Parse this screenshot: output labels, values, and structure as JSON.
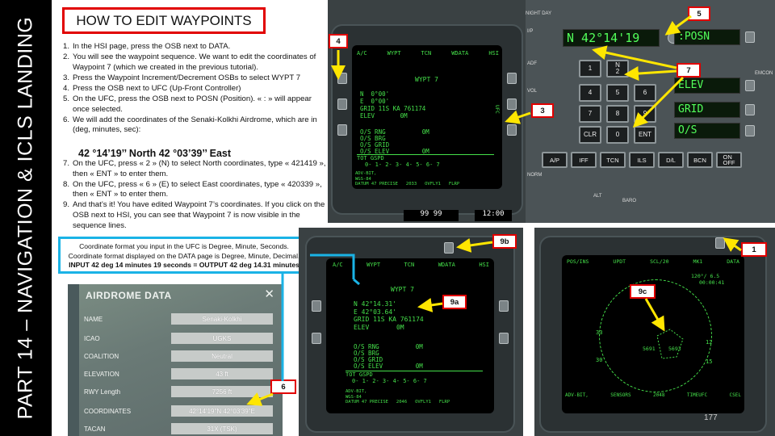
{
  "side_title": "PART 14 – NAVIGATION & ICLS LANDING",
  "title": "HOW TO EDIT WAYPOINTS",
  "steps": [
    {
      "num": "1.",
      "text": "In the HSI page, press the OSB next to DATA."
    },
    {
      "num": "2.",
      "text": "You will see the waypoint sequence. We want to edit the coordinates of Waypoint 7 (which we created in the previous tutorial)."
    },
    {
      "num": "3.",
      "text": "Press the Waypoint Increment/Decrement OSBs to select WYPT 7"
    },
    {
      "num": "4.",
      "text": "Press the OSB next to UFC (Up-Front Controller)"
    },
    {
      "num": "5.",
      "text": "On the UFC, press the OSB next to POSN (Position). « : » will appear once selected."
    },
    {
      "num": "6.",
      "text": "We will add the coordinates of the Senaki-Kolkhi Airdrome, which are in (deg, minutes, sec):"
    }
  ],
  "coordinates_line": "42 °14’19’’ North 42 °03’39’’ East",
  "steps_2": [
    {
      "num": "7.",
      "text": "On the UFC, press « 2 » (N) to select North coordinates, type « 421419 », then « ENT » to enter them."
    },
    {
      "num": "8.",
      "text": "On the UFC, press « 6 » (E) to select East coordinates, type « 420339 », then « ENT » to enter them."
    },
    {
      "num": "9.",
      "text": "And that’s it! You have edited Waypoint 7’s coordinates. If you click on the OSB next to HSI, you can see that Waypoint 7 is now visible in the sequence lines."
    }
  ],
  "info_box": {
    "line1": "Coordinate format you input in the UFC is Degree, Minute, Seconds.",
    "line2": "Coordinate format displayed on the DATA page is Degree, Minute, Decimal.",
    "line3": "INPUT 42 deg 14 minutes 19 seconds = OUTPUT 42 deg 14.31 minutes"
  },
  "airdrome": {
    "title": "AIRDROME DATA",
    "close": "✕",
    "rows": [
      {
        "label": "NAME",
        "value": "Senaki-Kolkhi"
      },
      {
        "label": "ICAO",
        "value": "UGKS"
      },
      {
        "label": "COALITION",
        "value": "Neutral"
      },
      {
        "label": "ELEVATION",
        "value": "43 ft"
      },
      {
        "label": "RWY Length",
        "value": "7256 ft"
      },
      {
        "label": "COORDINATES",
        "value": "42°14'19\"N 42°03'39\"E"
      },
      {
        "label": "TACAN",
        "value": "31X (TSK)"
      }
    ]
  },
  "ddi_top": {
    "tabs": [
      "A/C",
      "WYPT",
      "TCN",
      "WDATA",
      "HSI"
    ],
    "waypoint": "WYPT 7",
    "lines": [
      "N  0°00'",
      "E  0°00'",
      "GRID 11S KA 761174",
      "ELEV       0M"
    ],
    "lower_lines": [
      "O/S RNG          0M",
      "O/S BRG",
      "O/S GRID",
      "O/S ELEV         0M"
    ],
    "tot": "TOT          GSPD",
    "sequence": "0- 1- 2- 3- 4- 5- 6- 7",
    "footer": [
      "ADV-BIT,",
      "WGS-84",
      "DATUM 47 PRECISE   2033   OVFLY1   FLRP"
    ],
    "side_right": "UFC",
    "readout": "99  99",
    "clock": "12:00"
  },
  "ufc": {
    "nightday": "NIGHT   DAY",
    "scratchpad": "N 42°14'19",
    "options": [
      ":POSN",
      "ELEV",
      "GRID",
      "O/S"
    ],
    "keys": [
      [
        "",
        "N\n2",
        ""
      ],
      [
        "4",
        "5",
        "6"
      ],
      [
        "7",
        "8",
        "9"
      ],
      [
        "CLR",
        "0",
        "ENT"
      ]
    ],
    "key1": "1",
    "bottom_buttons": [
      "A/P",
      "IFF",
      "TCN",
      "ILS",
      "D/L",
      "BCN",
      "ON\nOFF"
    ],
    "labels": [
      "I/P",
      "ADF",
      "VOL",
      "EMCON",
      "NORM",
      "ALT",
      "BARO"
    ]
  },
  "ddi_mid": {
    "tabs": [
      "A/C",
      "WYPT",
      "TCN",
      "WDATA",
      "HSI"
    ],
    "waypoint": "WYPT 7",
    "lines": [
      "N 42°14.31'",
      "E 42°03.64'",
      "GRID 11S KA 761174",
      "ELEV       0M"
    ],
    "lower_lines": [
      "O/S RNG          0M",
      "O/S BRG",
      "O/S GRID",
      "O/S ELEV         0M"
    ],
    "tot": "TOT          GSPD",
    "sequence": "0- 1- 2- 3- 4- 5- 6- 7",
    "footer": [
      "ADV-BIT,",
      "WGS-84",
      "DATUM 47 PRECISE   2046   OVFLY1   FLRP"
    ]
  },
  "ddi_right": {
    "tabs": [
      "POS/INS",
      "UPDT",
      "SCL/20",
      "MK1",
      "DATA"
    ],
    "wp_label": "5691",
    "wp_label2": "5693",
    "numbers": [
      "33",
      "30",
      "12",
      "15"
    ],
    "top_right": "120°/ 6.5",
    "top_right2": "00:00:41",
    "footer": [
      "ADV-BIT,",
      "SENSORS",
      "2048",
      "TIMEUFC",
      "CSEL"
    ]
  },
  "tags": {
    "t1": "1",
    "t3": "3",
    "t4": "4",
    "t5": "5",
    "t6": "6",
    "t7": "7",
    "t9a": "9a",
    "t9b": "9b",
    "t9c": "9c"
  },
  "page_number": "177",
  "colors": {
    "red": "#e10000",
    "cyan": "#1ab3e6",
    "yellow": "#ffe600",
    "green": "#45e04a"
  }
}
